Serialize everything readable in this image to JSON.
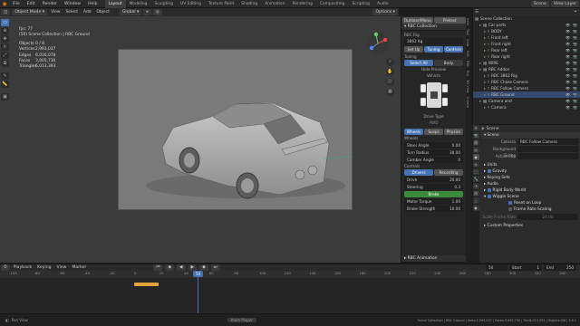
{
  "topbar": {
    "menus": [
      "File",
      "Edit",
      "Render",
      "Window",
      "Help"
    ],
    "workspaces": [
      "Layout",
      "Modeling",
      "Sculpting",
      "UV Editing",
      "Texture Paint",
      "Shading",
      "Animation",
      "Rendering",
      "Compositing",
      "Scripting",
      "Audio"
    ],
    "active_workspace": "Layout",
    "scene": "Scene",
    "view_layer": "View Layer"
  },
  "viewport_header": {
    "mode": "Object Mode",
    "menus": [
      "View",
      "Select",
      "Add",
      "Object"
    ],
    "orientation": "Global",
    "options": "Options"
  },
  "stats": {
    "title": "fps: 77",
    "collection": "(50) Scene Collection | RBC Ground",
    "objects_label": "Objects",
    "objects": "0 / 8",
    "vertices_label": "Vertices",
    "vertices": "2,993,037",
    "edges_label": "Edges",
    "edges": "6,016,078",
    "faces_label": "Faces",
    "faces": "3,005,730",
    "triangles_label": "Triangles",
    "triangles": "6,013,393"
  },
  "rbc_panel": {
    "header_tabs": [
      "Outliner/Menu",
      "Pretest"
    ],
    "title": "RBC Collection",
    "rig_label": "RBC Rig",
    "rig_value": "3862 Kg",
    "setup_buttons": [
      "Set Up",
      "Tuning",
      "Controls"
    ],
    "tuning": "Tuning",
    "select_all": "Select All",
    "body_label": "Body",
    "hide_preview": "Hide Preview",
    "vehicle": "Vehicle",
    "drive_type": "Drive Type",
    "drive_value": "AWD",
    "subtabs": [
      "Wheels",
      "Susps",
      "Physics"
    ],
    "wheels_label": "Wheels",
    "wheel_rows": [
      {
        "label": "Steer Angle",
        "value": "0.00"
      },
      {
        "label": "Turn Radius",
        "value": "30.00"
      },
      {
        "label": "Camber Angle",
        "value": "0"
      }
    ],
    "controls_label": "Controls",
    "control_tabs": [
      "Drivers",
      "Recording"
    ],
    "driver_rows": [
      {
        "label": "Drive",
        "value": "20.00"
      },
      {
        "label": "Steering",
        "value": "0.3"
      }
    ],
    "brake_label": "Brake",
    "motor_rows": [
      {
        "label": "Motor Torque",
        "value": "1.00"
      },
      {
        "label": "Brake Strength",
        "value": "10.00"
      }
    ],
    "rbc_animation": "RBC Animation",
    "vertical_tabs": [
      "Item",
      "Tool",
      "View",
      "Edit",
      "RBC",
      "Rig",
      "3D View",
      "Create"
    ]
  },
  "outliner": {
    "title": "Scene Collection",
    "items": [
      {
        "label": "Car parts",
        "depth": 1,
        "selected": false
      },
      {
        "label": "BODY",
        "depth": 2,
        "selected": false
      },
      {
        "label": "Front left",
        "depth": 2,
        "selected": false
      },
      {
        "label": "Front right",
        "depth": 2,
        "selected": false
      },
      {
        "label": "Rear left",
        "depth": 2,
        "selected": false
      },
      {
        "label": "Rear right",
        "depth": 2,
        "selected": false
      },
      {
        "label": "WIRE",
        "depth": 1,
        "selected": false
      },
      {
        "label": "RBC Addon",
        "depth": 1,
        "selected": false
      },
      {
        "label": "RBC 3862 Rig",
        "depth": 2,
        "selected": false
      },
      {
        "label": "RBC Chase Camera",
        "depth": 2,
        "selected": false
      },
      {
        "label": "RBC Follow Camera",
        "depth": 2,
        "selected": false
      },
      {
        "label": "RBC Ground",
        "depth": 2,
        "selected": true
      },
      {
        "label": "Camera and",
        "depth": 1,
        "selected": false
      },
      {
        "label": "Camera",
        "depth": 2,
        "selected": false
      }
    ]
  },
  "properties": {
    "breadcrumb": "Scene",
    "scene_section": "Scene",
    "camera_label": "Camera",
    "camera_value": "RBC Follow Camera",
    "background_label": "Background Scene",
    "active_clip_label": "Active Clip",
    "units": "Units",
    "gravity": "Gravity",
    "keying_sets": "Keying Sets",
    "audio": "Audio",
    "rigid_body_world": "Rigid Body World",
    "simulation": "Wiggle Scene",
    "reset_on_loop": "Reset on Loop",
    "frame_rate_scaling": "Frame Rate Scaling",
    "scale_frame_label": "Scale Frame Rate",
    "scale_frame_value": "24.00",
    "custom_props": "Custom Properties"
  },
  "timeline": {
    "menus": [
      "Playback",
      "Keying",
      "View",
      "Marker"
    ],
    "current_frame": "50",
    "start_label": "Start",
    "start": "1",
    "end_label": "End",
    "end": "250",
    "ticks": [
      "-100",
      "-80",
      "-60",
      "-40",
      "-20",
      "0",
      "20",
      "40",
      "60",
      "80",
      "100",
      "120",
      "140",
      "160",
      "180",
      "200",
      "220",
      "240",
      "260",
      "280",
      "300",
      "320",
      "340"
    ],
    "playhead_label": "50"
  },
  "status": {
    "left": "Pan View",
    "center": "Anim Player",
    "right": "Scene Collection | RBC Ground | Verts:2,993,037 | Faces:3,005,730 | Tris:6,013,393 | Objects:0/8 | 3.6.1"
  },
  "colors": {
    "accent": "#4772b3",
    "selected_row": "#33496d",
    "keyframe": "#e1a23a"
  }
}
